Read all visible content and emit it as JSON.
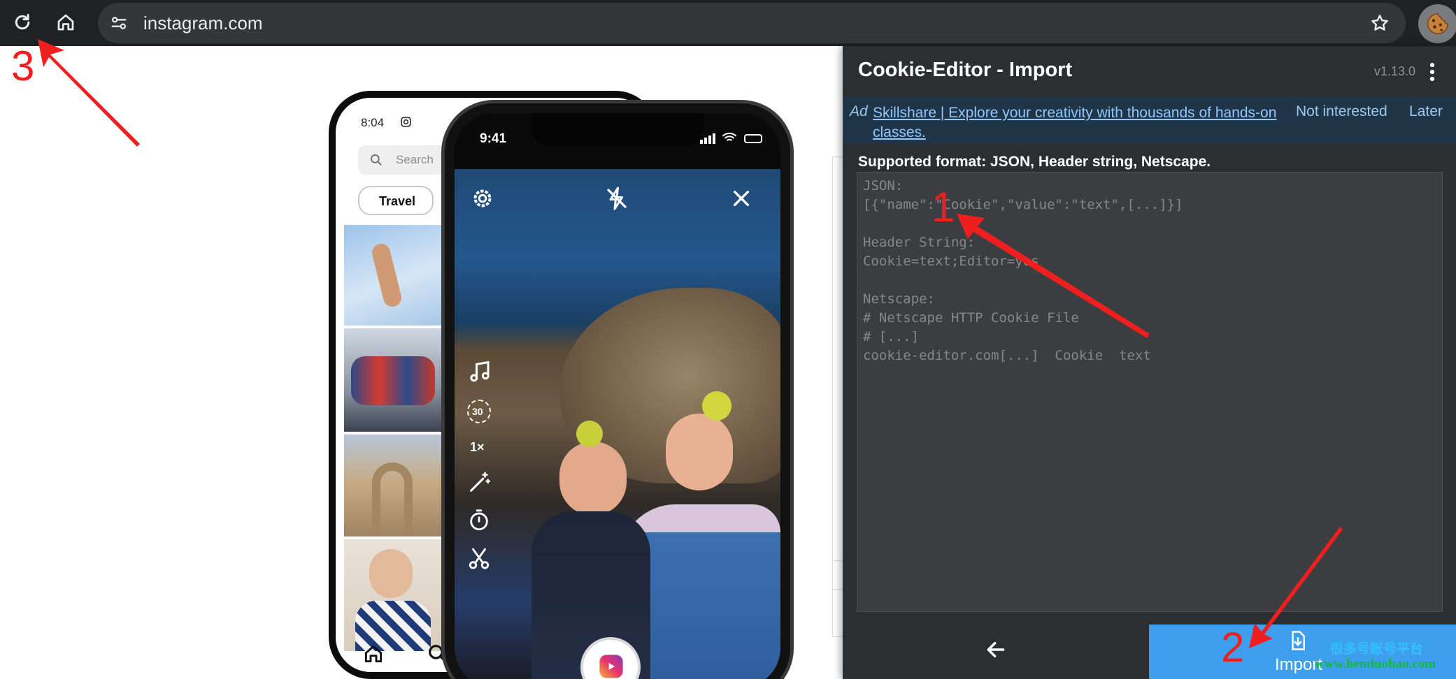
{
  "browser": {
    "url": "instagram.com",
    "icons": {
      "reload": "reload-icon",
      "home": "home-icon",
      "site_info": "tune-icon",
      "bookmark": "star-icon",
      "extension": "cookie-icon"
    }
  },
  "phones": {
    "back": {
      "time": "8:04",
      "search_placeholder": "Search",
      "chip": "Travel"
    },
    "front": {
      "time": "9:41",
      "speed": "1×",
      "timer_value": "30"
    }
  },
  "panel": {
    "title": "Cookie-Editor - Import",
    "version": "v1.13.0",
    "ad": {
      "label": "Ad",
      "text": "Skillshare | Explore your creativity with thousands of hands-on classes.",
      "not_interested": "Not interested",
      "later": "Later"
    },
    "format_label": "Supported format: JSON, Header string, Netscape.",
    "placeholder": "JSON:\n[{\"name\":\"Cookie\",\"value\":\"text\",[...]}]\n\nHeader String:\nCookie=text;Editor=yes\n\nNetscape:\n# Netscape HTTP Cookie File\n# [...]\ncookie-editor.com[...]  Cookie  text",
    "back_icon": "arrow-left-icon",
    "import_label": "Import"
  },
  "annotations": {
    "one": "1",
    "two": "2",
    "three": "3"
  },
  "watermark": {
    "line1": "很多号账号平台",
    "line2": "www.henduohao.com"
  },
  "colors": {
    "toolbar": "#202124",
    "panel": "#2d2e31",
    "import_button": "#3f9fef",
    "annotation": "#f01f1f"
  }
}
